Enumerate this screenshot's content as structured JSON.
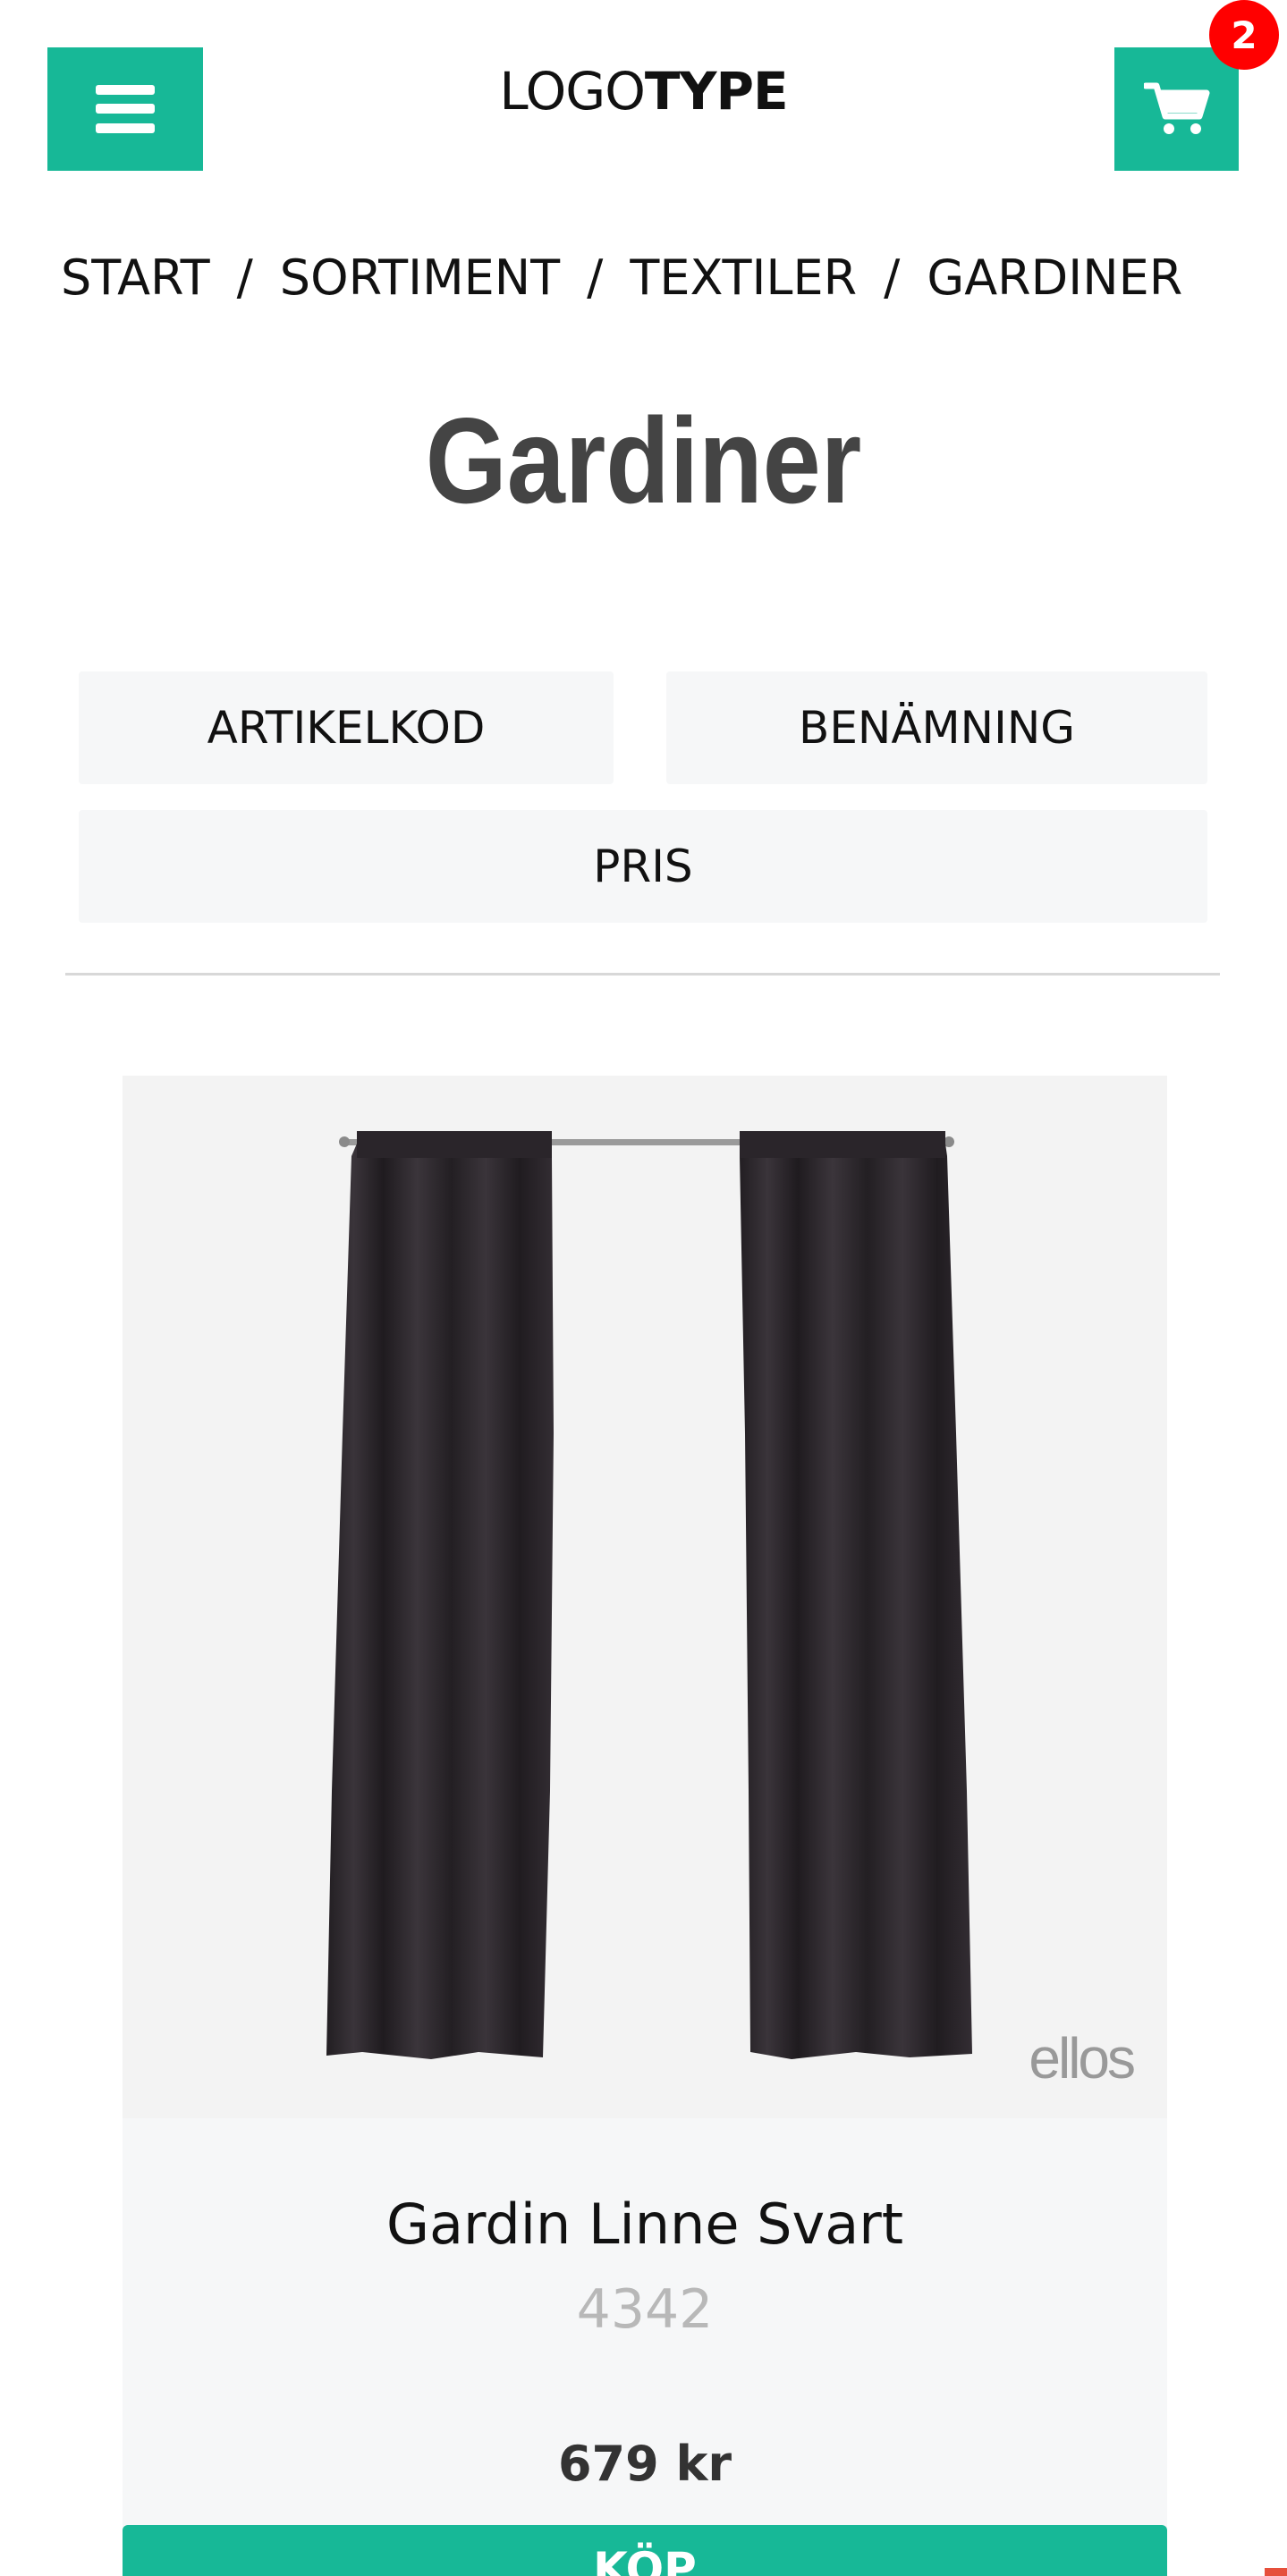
{
  "header": {
    "logo_light": "LOGO",
    "logo_bold": "TYPE",
    "cart_count": "2",
    "accent_color": "#17b897",
    "badge_color": "#ff0000",
    "menu_icon": "hamburger-icon",
    "cart_icon": "shopping-cart-icon"
  },
  "breadcrumb": {
    "items": [
      "START",
      "SORTIMENT",
      "TEXTILER",
      "GARDINER"
    ],
    "separator": "/"
  },
  "page": {
    "title": "Gardiner"
  },
  "sort": {
    "article_code": "ARTIKELKOD",
    "name": "BENÄMNING",
    "price": "PRIS"
  },
  "product": {
    "name": "Gardin Linne Svart",
    "code": "4342",
    "price": "679 kr",
    "brand_watermark": "ellos",
    "buy_label": "KÖP"
  }
}
